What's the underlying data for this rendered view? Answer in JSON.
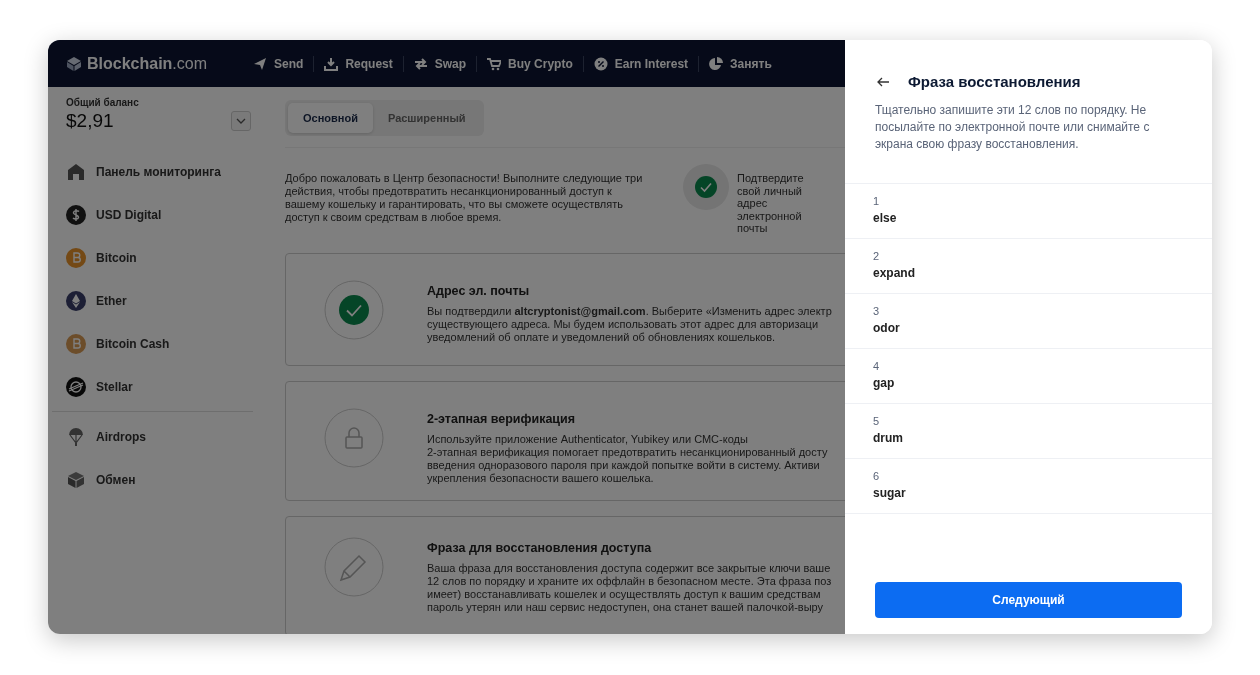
{
  "header": {
    "brand": "Blockchain",
    "brand_suffix": ".com",
    "nav": [
      {
        "label": "Send"
      },
      {
        "label": "Request"
      },
      {
        "label": "Swap"
      },
      {
        "label": "Buy Crypto"
      },
      {
        "label": "Earn Interest"
      },
      {
        "label": "Занять"
      }
    ]
  },
  "sidebar": {
    "balance_label": "Общий баланс",
    "balance": "$2,91",
    "items": [
      {
        "label": "Панель мониторинга",
        "kind": "home"
      },
      {
        "label": "USD Digital",
        "kind": "usd"
      },
      {
        "label": "Bitcoin",
        "kind": "btc"
      },
      {
        "label": "Ether",
        "kind": "eth"
      },
      {
        "label": "Bitcoin Cash",
        "kind": "bch"
      },
      {
        "label": "Stellar",
        "kind": "xlm"
      }
    ],
    "extras": [
      {
        "label": "Airdrops",
        "kind": "airdrop"
      },
      {
        "label": "Обмен",
        "kind": "exchange"
      }
    ]
  },
  "main": {
    "tabs": [
      {
        "label": "Основной",
        "selected": true
      },
      {
        "label": "Расширенный",
        "selected": false
      }
    ],
    "intro": "Добро пожаловать в Центр безопасности! Выполните следующие три действия, чтобы предотвратить несанкционированный доступ к вашему кошельку и гарантировать, что вы сможете осуществлять доступ к своим средствам в любое время.",
    "verify_badge": "Подтвердите свой личный адрес электронной почты",
    "cards": [
      {
        "kind": "done",
        "title": "Адрес эл. почты",
        "lines": [
          "Вы подтвердили **altcryptonist@gmail.com**. Выберите «Изменить адрес электр",
          "существующего адреса. Мы будем использовать этот адрес для авторизаци",
          "уведомлений об оплате и уведомлений об обновлениях кошельков."
        ]
      },
      {
        "kind": "lock",
        "title": "2-этапная верификация",
        "lines": [
          "Используйте приложение Authenticator, Yubikey или СМС-коды",
          "2-этапная верификация помогает предотвратить несанкционированный досту",
          "введения одноразового пароля при каждой попытке войти в систему. Активи",
          "укрепления безопасности вашего кошелька."
        ]
      },
      {
        "kind": "pencil",
        "title": "Фраза для восстановления доступа",
        "lines": [
          "Ваша фраза для восстановления доступа содержит все закрытые ключи ваше",
          "12 слов по порядку и храните их оффлайн в безопасном месте. Эта фраза поз",
          "имеет) восстанавливать кошелек и осуществлять доступ к вашим средствам",
          "пароль утерян или наш сервис недоступен, она станет вашей палочкой-выру"
        ]
      }
    ]
  },
  "drawer": {
    "title": "Фраза восстановления",
    "description": "Тщательно запишите эти 12 слов по порядку. Не посылайте по электронной почте или снимайте с экрана свою фразу восстановления.",
    "words": [
      {
        "number": "1",
        "word": "else"
      },
      {
        "number": "2",
        "word": "expand"
      },
      {
        "number": "3",
        "word": "odor"
      },
      {
        "number": "4",
        "word": "gap"
      },
      {
        "number": "5",
        "word": "drum"
      },
      {
        "number": "6",
        "word": "sugar"
      }
    ],
    "next_button": "Следующий"
  }
}
